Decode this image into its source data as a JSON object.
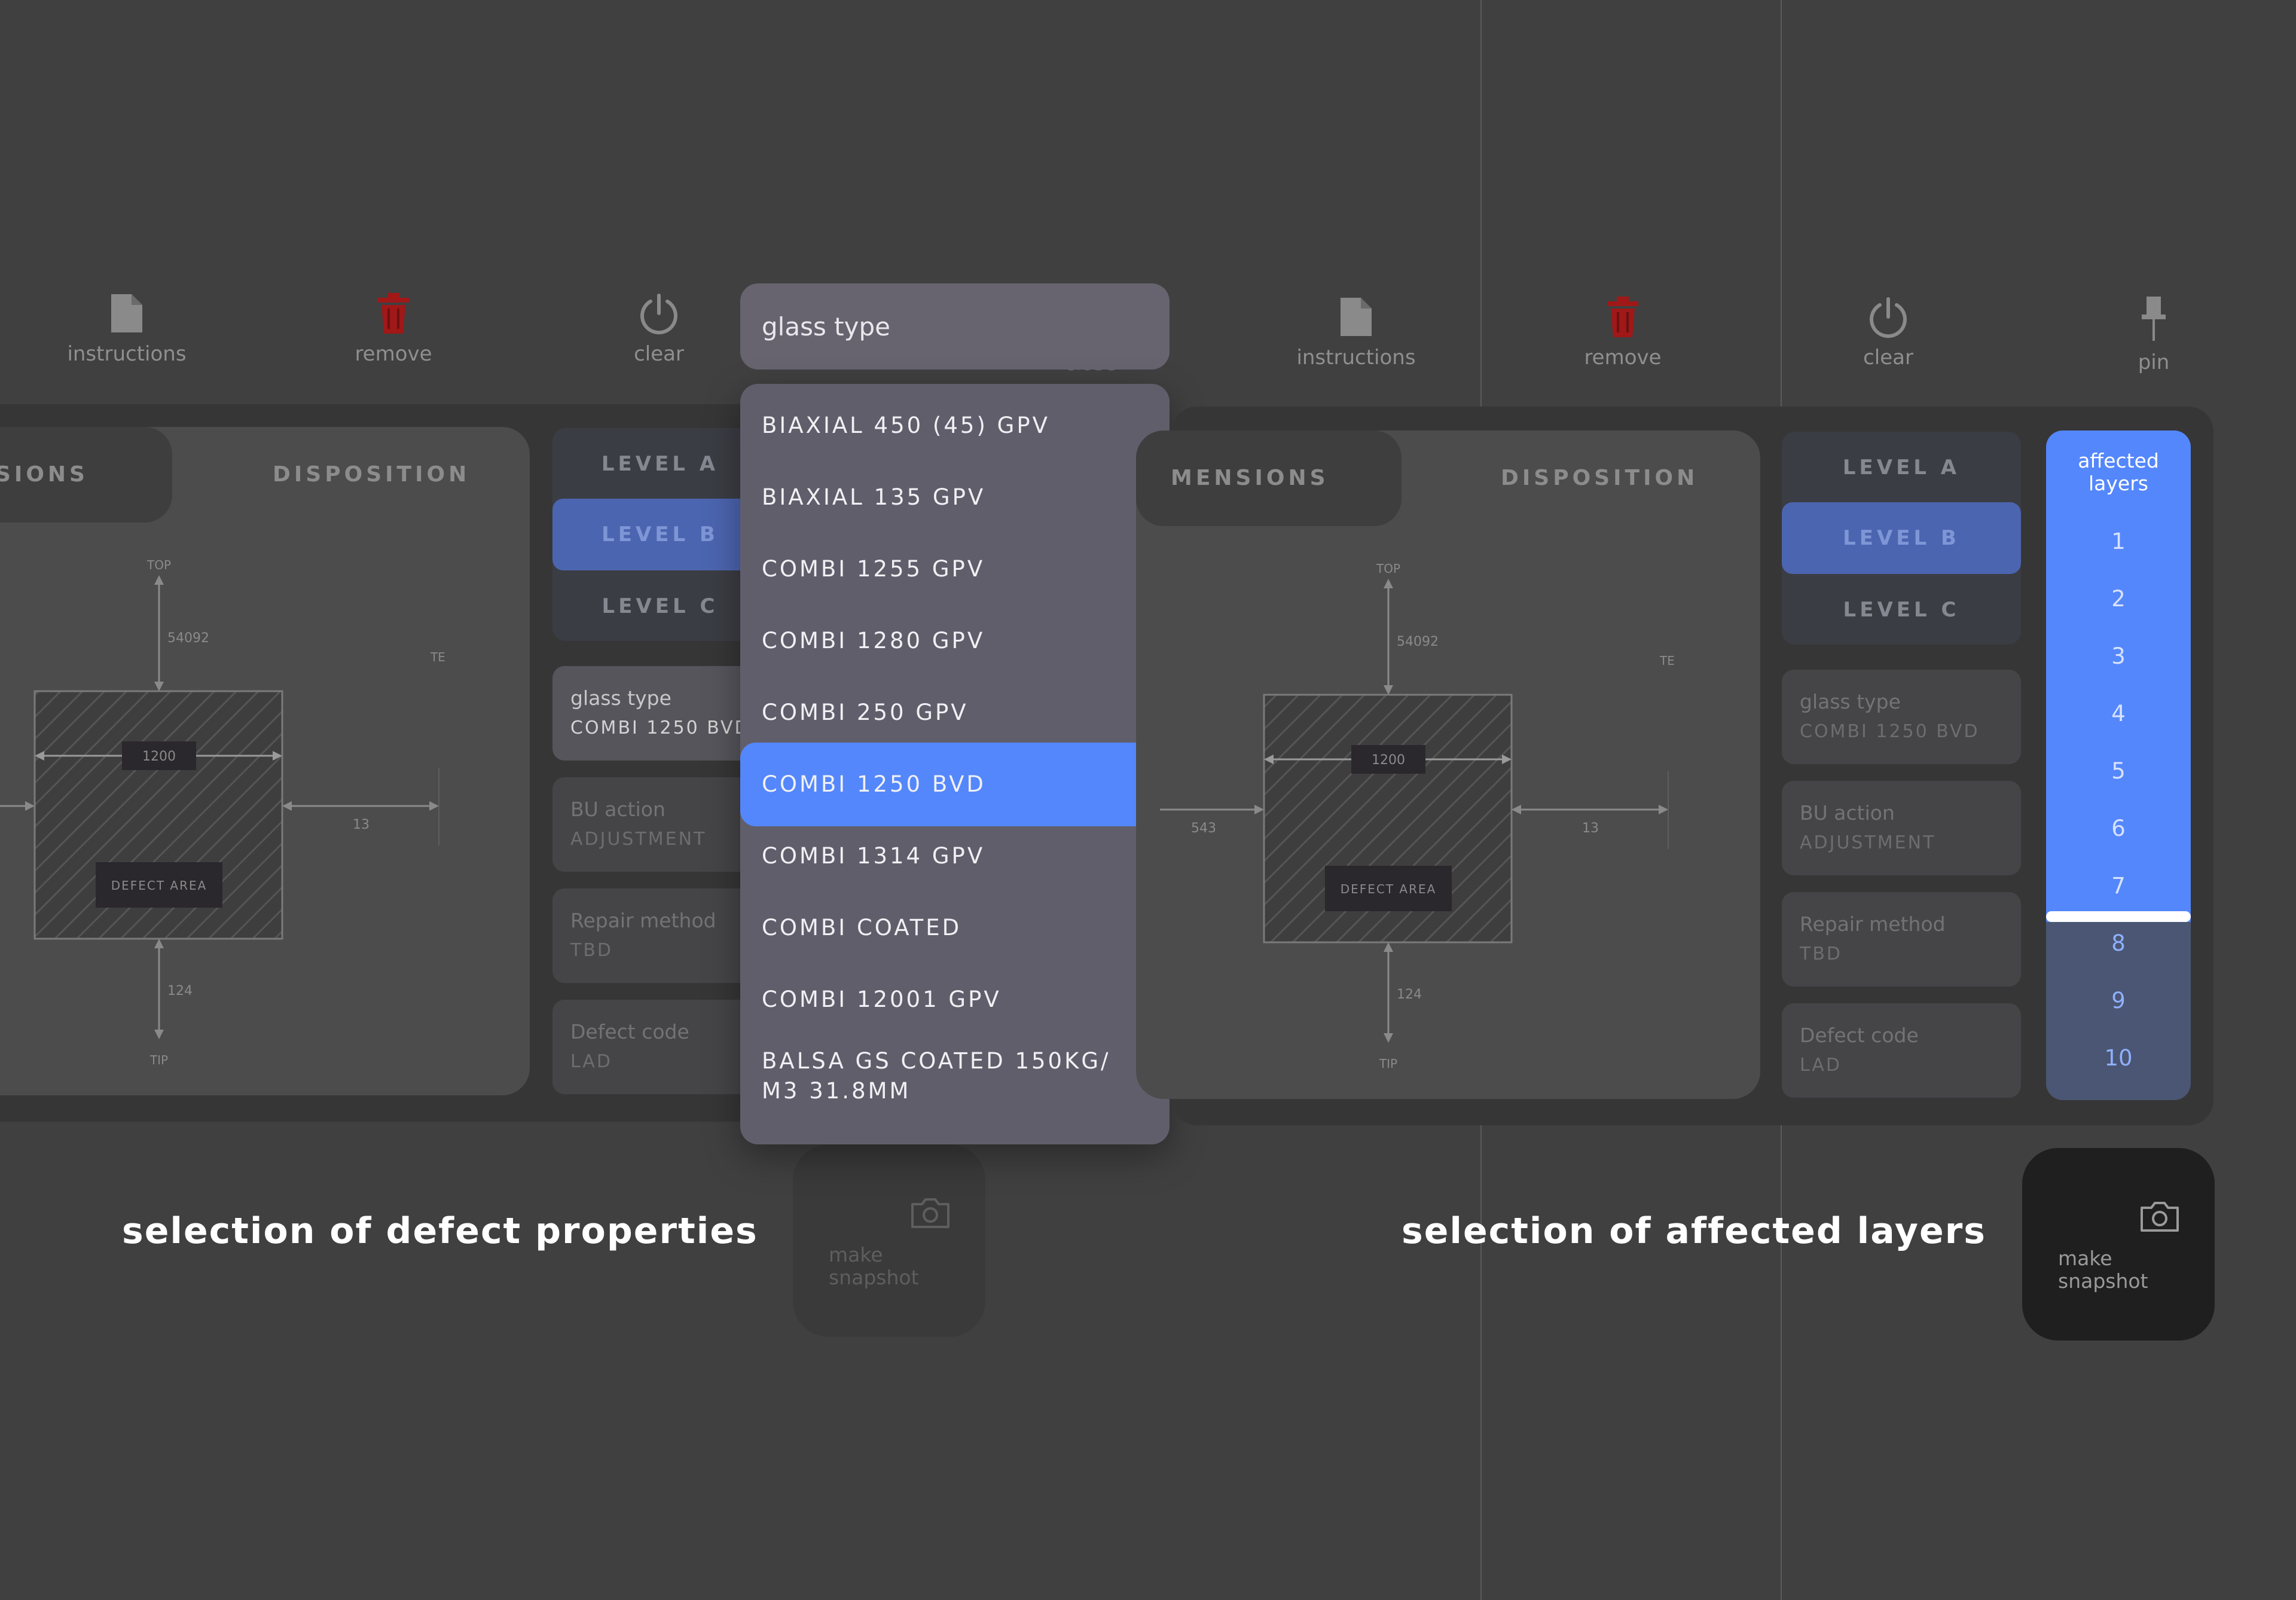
{
  "toolbar_left": {
    "instructions": "instructions",
    "remove": "remove",
    "clear": "clear",
    "close_partial": "close"
  },
  "toolbar_right": {
    "instructions": "instructions",
    "remove": "remove",
    "clear": "clear",
    "pin": "pin"
  },
  "left_panel": {
    "tab_dimensions": "SIONS",
    "tab_disposition": "DISPOSITION",
    "diagram": {
      "top": "TOP",
      "tip": "TIP",
      "te": "TE",
      "dim_top": "54092",
      "dim_width": "1200",
      "dim_right": "13",
      "dim_bottom": "124",
      "defect_area": "DEFECT AREA"
    },
    "levels": [
      "LEVEL A",
      "LEVEL B",
      "LEVEL C"
    ],
    "cards": [
      {
        "title": "glass type",
        "value": "COMBI 1250 BVD"
      },
      {
        "title": "BU action",
        "value": "ADJUSTMENT"
      },
      {
        "title": "Repair method",
        "value": "TBD"
      },
      {
        "title": "Defect code",
        "value": "LAD"
      }
    ]
  },
  "right_panel": {
    "tab_dimensions": "MENSIONS",
    "tab_disposition": "DISPOSITION",
    "diagram": {
      "top": "TOP",
      "tip": "TIP",
      "te": "TE",
      "dim_top": "54092",
      "dim_width": "1200",
      "dim_left": "543",
      "dim_right": "13",
      "dim_bottom": "124",
      "defect_area": "DEFECT AREA"
    },
    "levels": [
      "LEVEL A",
      "LEVEL B",
      "LEVEL C"
    ],
    "cards": [
      {
        "title": "glass type",
        "value": "COMBI 1250 BVD"
      },
      {
        "title": "BU action",
        "value": "ADJUSTMENT"
      },
      {
        "title": "Repair method",
        "value": "TBD"
      },
      {
        "title": "Defect code",
        "value": "LAD"
      }
    ]
  },
  "dropdown": {
    "header": "glass type",
    "selected": "COMBI 1250 BVD",
    "options": [
      "BIAXIAL 450 (45) GPV",
      "BIAXIAL 135 GPV",
      "COMBI 1255 GPV",
      "COMBI 1280 GPV",
      "COMBI 250 GPV",
      "COMBI 1250 BVD",
      "COMBI 1314 GPV",
      "COMBI COATED",
      "COMBI 12001 GPV",
      "BALSA GS COATED 150KG/ M3 31.8MM"
    ]
  },
  "affected_layers": {
    "title": "affected layers",
    "layers": [
      "1",
      "2",
      "3",
      "4",
      "5",
      "6",
      "7",
      "8",
      "9",
      "10"
    ],
    "selected_up_to": 7
  },
  "snapshot_left": {
    "label": "make snapshot"
  },
  "snapshot_right": {
    "label": "make snapshot"
  },
  "captions": {
    "left": "selection of defect properties",
    "right": "selection of affected layers"
  },
  "colors": {
    "background": "#404040",
    "accent_blue": "#5487fb",
    "remove_red": "#b01c1c",
    "dropdown_bg": "#615e6b"
  },
  "icons": {
    "instructions": "document-icon",
    "remove": "trash-icon",
    "clear": "power-icon",
    "pin": "pin-icon",
    "snapshot": "camera-icon"
  }
}
